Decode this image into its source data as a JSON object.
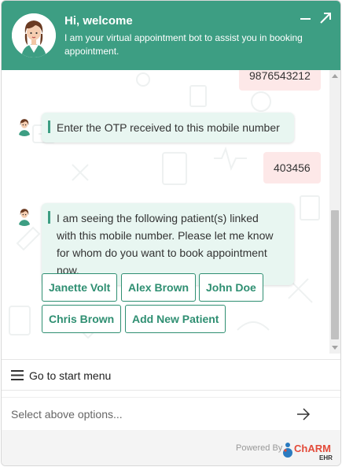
{
  "header": {
    "title": "Hi, welcome",
    "subtitle": "I am your virtual appointment bot to assist you in booking appointment.",
    "brand_color": "#3d9e83"
  },
  "chat": {
    "messages": [
      {
        "from": "user",
        "text": "9876543212"
      },
      {
        "from": "bot",
        "text": "Enter the OTP received to this mobile number"
      },
      {
        "from": "user",
        "text": "403456"
      },
      {
        "from": "bot",
        "text": "I am seeing the following patient(s) linked with this mobile number. Please let me know for whom do you want to book appointment now."
      }
    ],
    "options": [
      "Janette Volt",
      "Alex Brown",
      "John Doe",
      "Chris Brown",
      "Add New Patient"
    ],
    "user_bubble_color": "#fde8e8",
    "bot_bubble_color": "#e8f6f1"
  },
  "menu": {
    "label": "Go to start menu"
  },
  "input": {
    "placeholder": "Select above options..."
  },
  "footer": {
    "powered_by": "Powered By",
    "logo_text": "ChARM",
    "logo_subtext": "EHR"
  }
}
